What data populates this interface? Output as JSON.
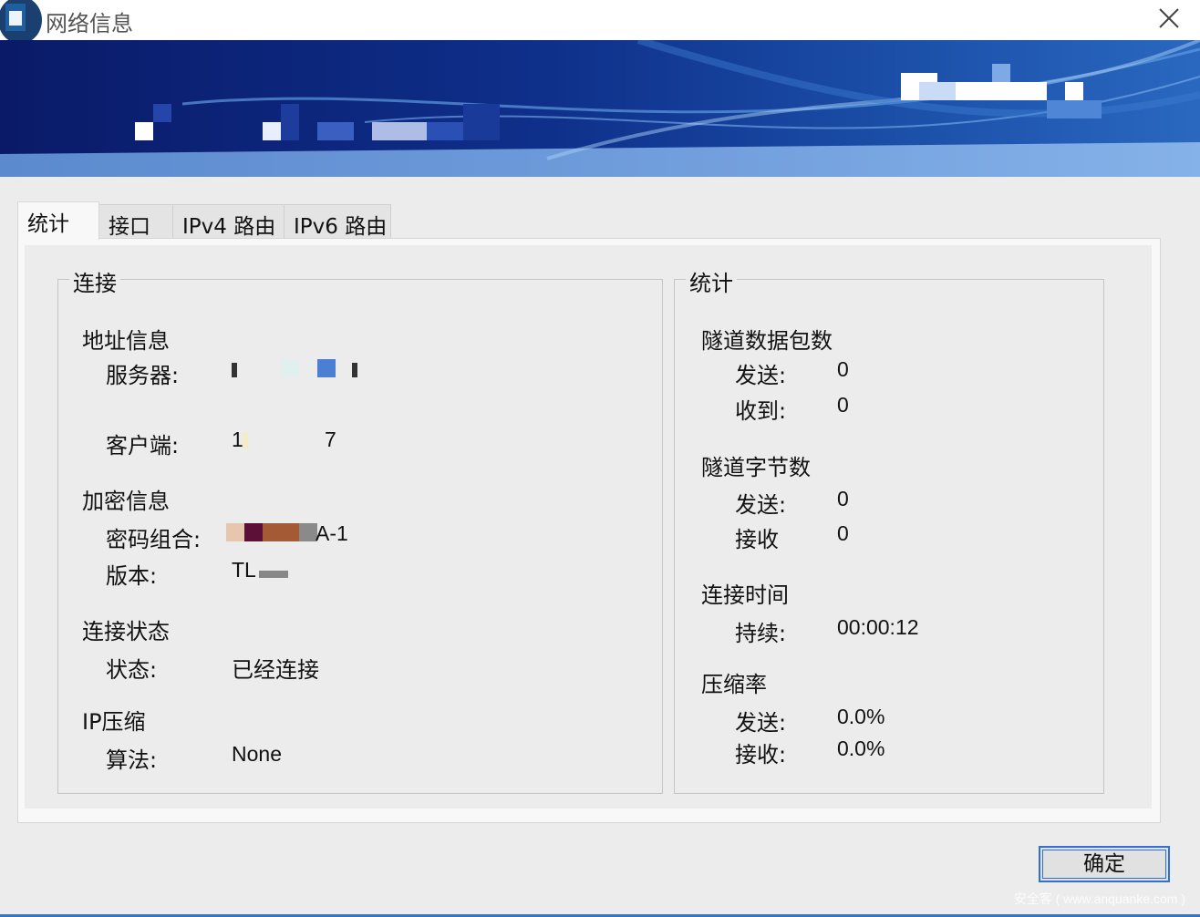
{
  "window": {
    "title": "网络信息",
    "close_icon": "close-icon"
  },
  "tabs": [
    {
      "label": "统计",
      "active": true
    },
    {
      "label": "接口",
      "active": false
    },
    {
      "label": "IPv4 路由",
      "active": false
    },
    {
      "label": "IPv6 路由",
      "active": false
    }
  ],
  "connection": {
    "legend": "连接",
    "address_heading": "地址信息",
    "server_label": "服务器:",
    "server_value": "",
    "client_label": "客户端:",
    "client_value_start": "1",
    "client_value_end": "7",
    "encryption_heading": "加密信息",
    "cipher_label": "密码组合:",
    "cipher_value_start": "S",
    "cipher_value_end": "A-1",
    "version_label": "版本:",
    "version_value": "TL",
    "status_heading": "连接状态",
    "status_label": "状态:",
    "status_value": "已经连接",
    "compression_heading": "IP压缩",
    "algorithm_label": "算法:",
    "algorithm_value": "None"
  },
  "statistics": {
    "legend": "统计",
    "packets_heading": "隧道数据包数",
    "packets_sent_label": "发送:",
    "packets_sent_value": "0",
    "packets_received_label": "收到:",
    "packets_received_value": "0",
    "bytes_heading": "隧道字节数",
    "bytes_sent_label": "发送:",
    "bytes_sent_value": "0",
    "bytes_received_label": "接收",
    "bytes_received_value": "0",
    "time_heading": "连接时间",
    "duration_label": "持续:",
    "duration_value": "00:00:12",
    "ratio_heading": "压缩率",
    "ratio_sent_label": "发送:",
    "ratio_sent_value": "0.0%",
    "ratio_received_label": "接收:",
    "ratio_received_value": "0.0%"
  },
  "buttons": {
    "ok_label": "确定"
  },
  "watermark": "安全客 ( www.anquanke.com )",
  "colors": {
    "banner_dark": "#0a1e6e",
    "banner_light": "#3d7dd0",
    "accent_border": "#2f6fd6"
  }
}
